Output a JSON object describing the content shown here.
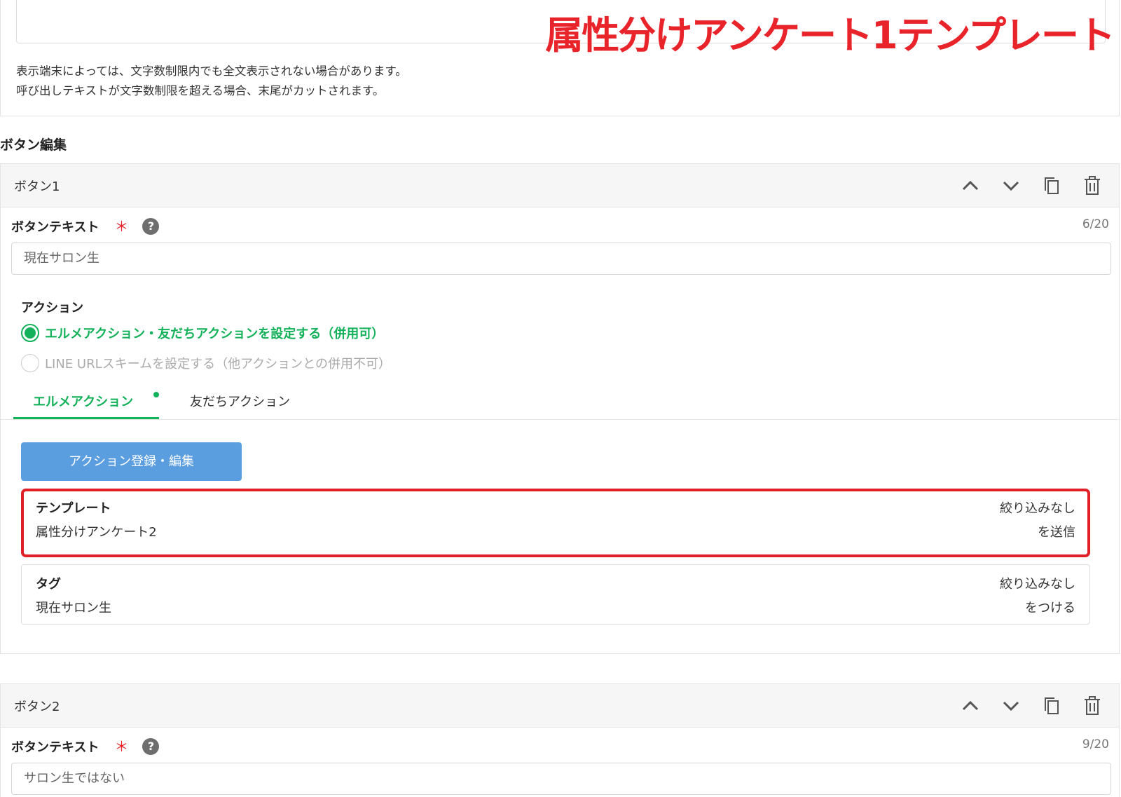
{
  "overlay_title": "属性分けアンケート1テンプレート",
  "message_notes": [
    "表示端末によっては、文字数制限内でも全文表示されない場合があります。",
    "呼び出しテキストが文字数制限を超える場合、末尾がカットされます。"
  ],
  "section_title": "ボタン編集",
  "card_icons": [
    "chevron-up-icon",
    "chevron-down-icon",
    "copy-icon",
    "trash-icon"
  ],
  "button1": {
    "title": "ボタン1",
    "text_label": "ボタンテキスト",
    "required_mark": "＊",
    "help_glyph": "?",
    "counter": "6/20",
    "text_value": "現在サロン生",
    "action_label": "アクション",
    "radio_options": [
      {
        "label": "エルメアクション・友だちアクションを設定する（併用可）",
        "selected": true
      },
      {
        "label": "LINE URLスキームを設定する（他アクションとの併用不可）",
        "selected": false
      }
    ],
    "tabs": [
      {
        "label": "エルメアクション",
        "active": true
      },
      {
        "label": "友だちアクション",
        "active": false
      }
    ],
    "register_button": "アクション登録・編集",
    "actions": [
      {
        "key": "テンプレート",
        "value": "属性分けアンケート2",
        "filter": "絞り込みなし",
        "verb": "を送信",
        "highlighted": true
      },
      {
        "key": "タグ",
        "value": "現在サロン生",
        "filter": "絞り込みなし",
        "verb": "をつける",
        "highlighted": false
      }
    ]
  },
  "button2": {
    "title": "ボタン2",
    "text_label": "ボタンテキスト",
    "required_mark": "＊",
    "help_glyph": "?",
    "counter": "9/20",
    "text_value": "サロン生ではない"
  },
  "colors": {
    "accent_green": "#13b25a",
    "action_blue": "#5b9ee0",
    "highlight_red": "#e01f26",
    "overlay_red": "#e8232a"
  }
}
